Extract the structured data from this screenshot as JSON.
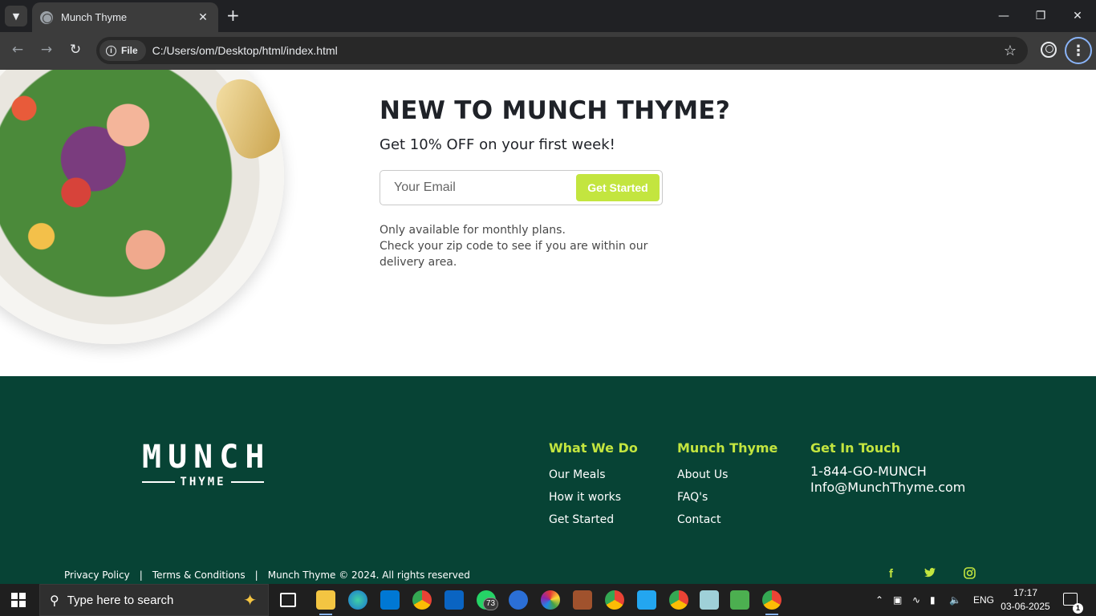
{
  "browser": {
    "tab_title": "Munch Thyme",
    "site_chip": "File",
    "url": "C:/Users/om/Desktop/html/index.html"
  },
  "promo": {
    "title": "NEW TO MUNCH THYME?",
    "subtitle": "Get 10% OFF on your first week!",
    "email_placeholder": "Your Email",
    "cta_label": "Get Started",
    "note_lines": [
      "Only available for monthly plans.",
      "Check your zip code to see if you are within our",
      "delivery area."
    ]
  },
  "footer": {
    "logo_main": "MUNCH",
    "logo_sub": "THYME",
    "columns": [
      {
        "heading": "What We Do",
        "links": [
          "Our Meals",
          "How it works",
          "Get Started"
        ]
      },
      {
        "heading": "Munch Thyme",
        "links": [
          "About Us",
          "FAQ's",
          "Contact"
        ]
      }
    ],
    "contact": {
      "heading": "Get In Touch",
      "phone": "1-844-GO-MUNCH",
      "email": "Info@MunchThyme.com"
    },
    "legal": {
      "privacy": "Privacy Policy",
      "terms": "Terms & Conditions",
      "copyright": "Munch Thyme © 2024. All rights reserved"
    },
    "social": [
      "facebook-icon",
      "twitter-icon",
      "instagram-icon"
    ],
    "colors": {
      "background": "#074335",
      "accent": "#c3e53f"
    }
  },
  "taskbar": {
    "search_placeholder": "Type here to search",
    "whatsapp_badge": "73",
    "language": "ENG",
    "time": "17:17",
    "date": "03-06-2025",
    "notification_count": "1"
  }
}
